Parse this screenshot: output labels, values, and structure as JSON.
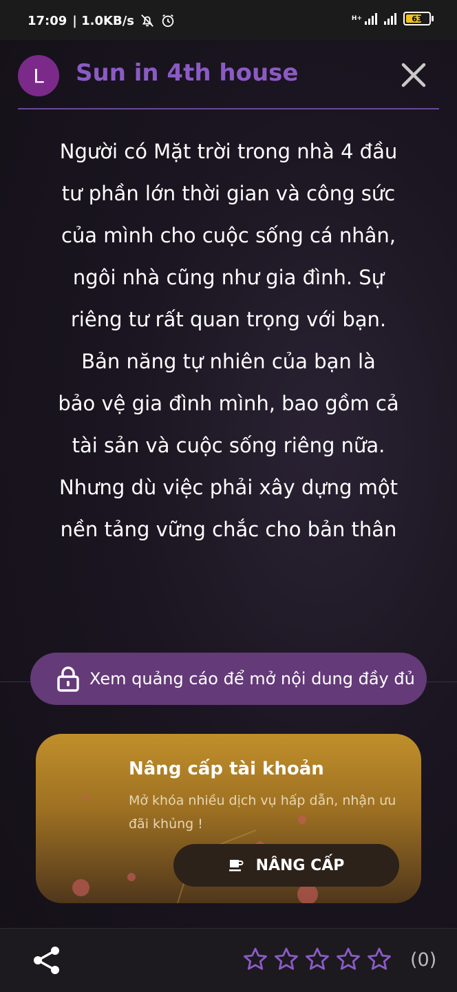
{
  "status_bar": {
    "time": "17:09",
    "speed": "| 1.0KB/s",
    "network_label": "H+",
    "battery": "63"
  },
  "header": {
    "avatar_letter": "L",
    "title": "Sun in 4th house"
  },
  "content": {
    "lines": [
      "Người có Mặt trời trong nhà 4 đầu",
      "tư phần lớn thời gian và công sức",
      "của mình cho cuộc sống cá nhân,",
      "ngôi nhà cũng như gia đình. Sự",
      "riêng tư rất quan trọng với bạn.",
      "Bản năng tự nhiên của bạn là",
      "bảo vệ gia đình mình, bao gồm cả",
      "tài sản và cuộc sống riêng nữa.",
      "Nhưng dù việc phải xây dựng một",
      "nền tảng vững chắc cho bản thân"
    ]
  },
  "ad_unlock": {
    "label": "Xem quảng cáo để mở nội dung đầy đủ",
    "icon": "lock-icon"
  },
  "upgrade": {
    "title": "Nâng cấp tài khoản",
    "description": "Mở khóa nhiều dịch vụ hấp dẫn, nhận ưu đãi khủng !",
    "button_label": "NÂNG CẤP",
    "button_icon": "coffee-cup-icon"
  },
  "bottom_bar": {
    "rating_value": 0,
    "rating_max": 5,
    "rating_count": "(0)"
  },
  "colors": {
    "accent_purple": "#8b5bc4",
    "ad_button": "#643a78",
    "star_outline": "#8b5bc4",
    "upgrade_gold": "#c08f2b"
  }
}
